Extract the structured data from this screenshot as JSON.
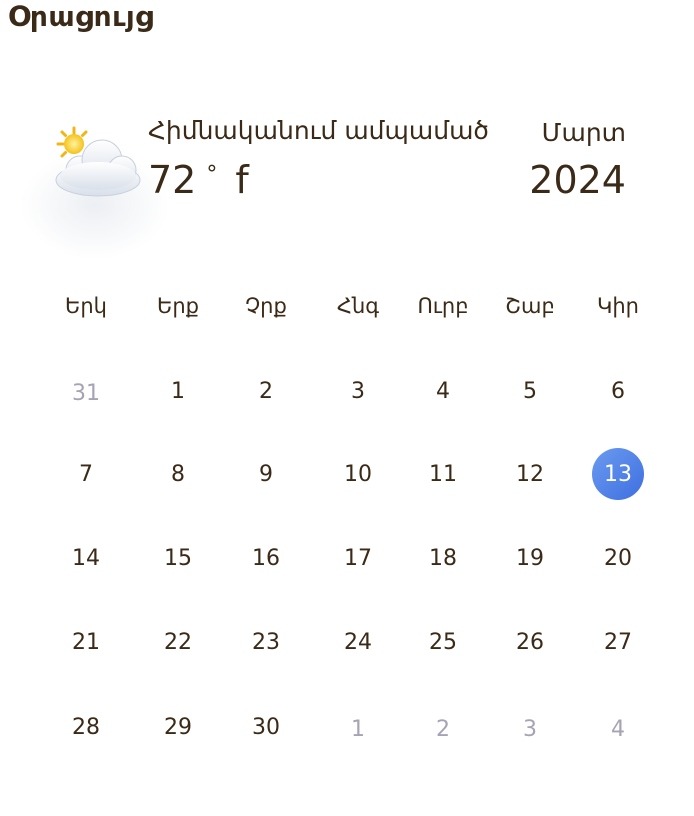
{
  "header": {
    "title": "Օրացույց"
  },
  "weather": {
    "icon": "partly-cloudy-icon",
    "condition": "Հիմնականում ամպամած",
    "temperature": "72",
    "degree_symbol": "°",
    "unit": "f"
  },
  "period": {
    "month": "Մարտ",
    "year": "2024"
  },
  "calendar": {
    "weekdays": [
      "Երկ",
      "Երք",
      "Չրք",
      "Հնգ",
      "Ուրբ",
      "Շաբ",
      "Կիր"
    ],
    "weeks": [
      [
        {
          "day": "31",
          "muted": true
        },
        {
          "day": "1"
        },
        {
          "day": "2"
        },
        {
          "day": "3"
        },
        {
          "day": "4"
        },
        {
          "day": "5"
        },
        {
          "day": "6"
        }
      ],
      [
        {
          "day": "7"
        },
        {
          "day": "8"
        },
        {
          "day": "9"
        },
        {
          "day": "10"
        },
        {
          "day": "11"
        },
        {
          "day": "12"
        },
        {
          "day": "13",
          "selected": true
        }
      ],
      [
        {
          "day": "14"
        },
        {
          "day": "15"
        },
        {
          "day": "16"
        },
        {
          "day": "17"
        },
        {
          "day": "18"
        },
        {
          "day": "19"
        },
        {
          "day": "20"
        }
      ],
      [
        {
          "day": "21"
        },
        {
          "day": "22"
        },
        {
          "day": "23"
        },
        {
          "day": "24"
        },
        {
          "day": "25"
        },
        {
          "day": "26"
        },
        {
          "day": "27"
        }
      ],
      [
        {
          "day": "28"
        },
        {
          "day": "29"
        },
        {
          "day": "30"
        },
        {
          "day": "1",
          "muted": true
        },
        {
          "day": "2",
          "muted": true
        },
        {
          "day": "3",
          "muted": true
        },
        {
          "day": "4",
          "muted": true
        }
      ]
    ]
  },
  "colors": {
    "text": "#3a2a17",
    "muted": "#a6a3b5",
    "selected_start": "#6c9bf0",
    "selected_end": "#3d6fe0"
  }
}
